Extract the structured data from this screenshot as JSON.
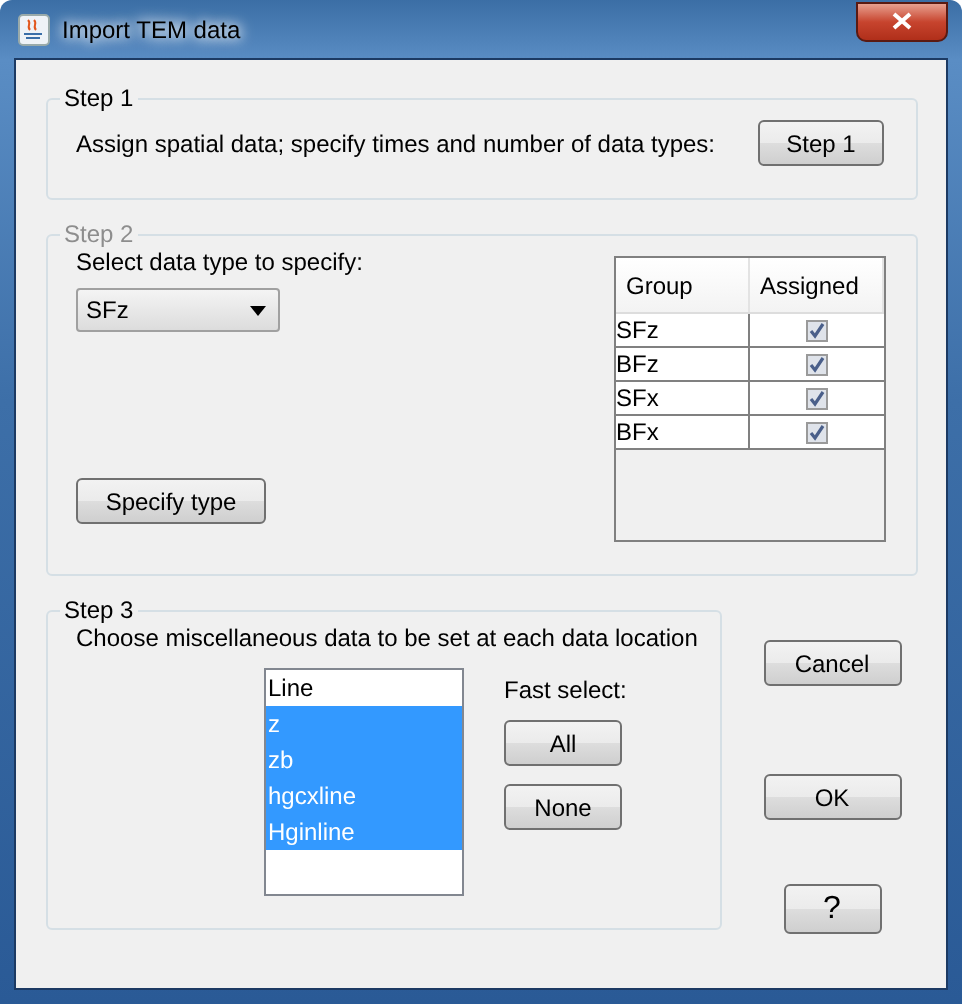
{
  "window": {
    "title": "Import TEM data"
  },
  "step1": {
    "legend": "Step 1",
    "text": "Assign spatial data; specify times and number of data types:",
    "button": "Step 1"
  },
  "step2": {
    "legend": "Step 2",
    "disabled": true,
    "label": "Select data type to specify:",
    "dropdown": "SFz",
    "button": "Specify type",
    "table": {
      "columns": [
        "Group",
        "Assigned"
      ],
      "rows": [
        {
          "group": "SFz",
          "assigned": true
        },
        {
          "group": "BFz",
          "assigned": true
        },
        {
          "group": "SFx",
          "assigned": true
        },
        {
          "group": "BFx",
          "assigned": true
        }
      ]
    }
  },
  "step3": {
    "legend": "Step 3",
    "text": "Choose miscellaneous data to be set at each data location",
    "items": [
      {
        "label": "Line",
        "selected": false
      },
      {
        "label": "z",
        "selected": true
      },
      {
        "label": "zb",
        "selected": true
      },
      {
        "label": "hgcxline",
        "selected": true
      },
      {
        "label": "Hginline",
        "selected": true
      }
    ],
    "fast_select": "Fast select:",
    "buttons": [
      "All",
      "None"
    ]
  },
  "side_buttons": [
    "Cancel",
    "OK",
    "?"
  ]
}
